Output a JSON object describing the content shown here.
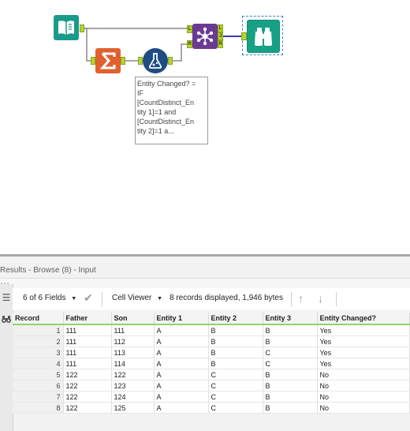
{
  "workflow": {
    "input_tool": {
      "icon": "book-icon"
    },
    "summarize_tool": {
      "icon": "sigma-icon"
    },
    "formula_tool": {
      "icon": "flask-icon"
    },
    "join_tool": {
      "icon": "network-icon",
      "anchors": [
        "L",
        "J",
        "R"
      ]
    },
    "browse_tool": {
      "icon": "binoculars-icon"
    },
    "formula_anchor_label": "R",
    "annotation": "Entity Changed? =\nIF\n[CountDistinct_En\ntity 1]=1 and\n[CountDistinct_En\ntity 2]=1 a..."
  },
  "results": {
    "title": "Results - Browse (8) - Input",
    "toolbar": {
      "fields_label": "6 of 6 Fields",
      "cell_viewer_label": "Cell Viewer",
      "records_info": "8 records displayed, 1,946 bytes"
    },
    "columns": [
      "Record",
      "Father",
      "Son",
      "Entity 1",
      "Entity 2",
      "Entity 3",
      "Entity Changed?"
    ],
    "rows": [
      [
        "1",
        "111",
        "111",
        "A",
        "B",
        "B",
        "Yes"
      ],
      [
        "2",
        "111",
        "112",
        "A",
        "B",
        "B",
        "Yes"
      ],
      [
        "3",
        "111",
        "113",
        "A",
        "B",
        "C",
        "Yes"
      ],
      [
        "4",
        "111",
        "114",
        "A",
        "B",
        "C",
        "Yes"
      ],
      [
        "5",
        "122",
        "122",
        "A",
        "C",
        "B",
        "No"
      ],
      [
        "6",
        "122",
        "123",
        "A",
        "C",
        "B",
        "No"
      ],
      [
        "7",
        "122",
        "124",
        "A",
        "C",
        "B",
        "No"
      ],
      [
        "8",
        "122",
        "125",
        "A",
        "C",
        "B",
        "No"
      ]
    ]
  },
  "colors": {
    "input": "#1a9a8a",
    "summarize": "#e0602f",
    "formula": "#1d4d82",
    "join": "#6b3a91",
    "browse": "#16a085",
    "anchor": "#b5d334",
    "grid_header_underline": "#8fd36a"
  }
}
